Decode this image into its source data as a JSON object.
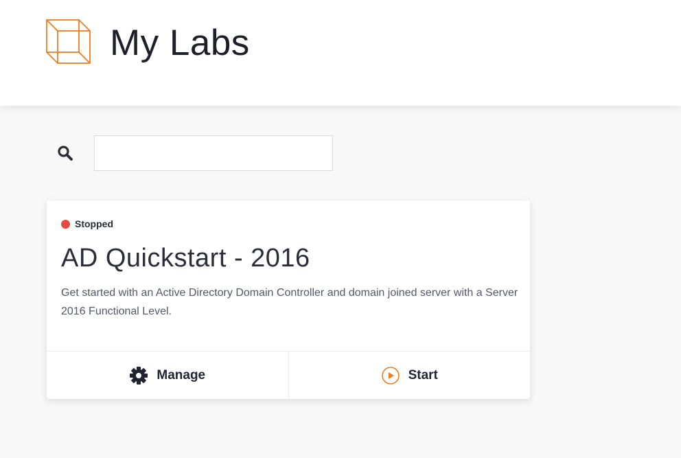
{
  "header": {
    "title": "My Labs",
    "logo_icon": "wireframe-cube-icon",
    "logo_color": "#ee7d1f"
  },
  "search": {
    "icon": "search-icon",
    "value": "",
    "placeholder": ""
  },
  "labs": [
    {
      "status": "Stopped",
      "status_color": "#e84a3f",
      "title": "AD Quickstart - 2016",
      "description": "Get started with an Active Directory Domain Controller and domain joined server with a Server 2016 Functional Level.",
      "actions": {
        "manage_label": "Manage",
        "manage_icon": "gear-icon",
        "start_label": "Start",
        "start_icon": "play-circle-icon",
        "start_icon_color": "#ee7d1f"
      }
    }
  ]
}
